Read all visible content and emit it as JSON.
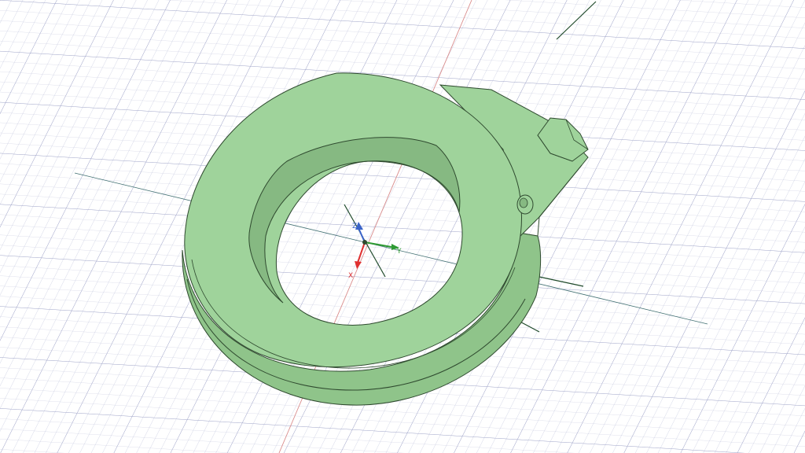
{
  "viewport": {
    "background": "#ffffff",
    "grid_color": "#8f94bd",
    "model_color": "#9fd39b",
    "model_edge_color": "#2f4a2f"
  },
  "axes": {
    "x": {
      "label": "X",
      "color": "#e03030"
    },
    "y": {
      "label": "Y",
      "color": "#2e9a33"
    },
    "z": {
      "label": "Z",
      "color": "#3a63c8"
    }
  }
}
